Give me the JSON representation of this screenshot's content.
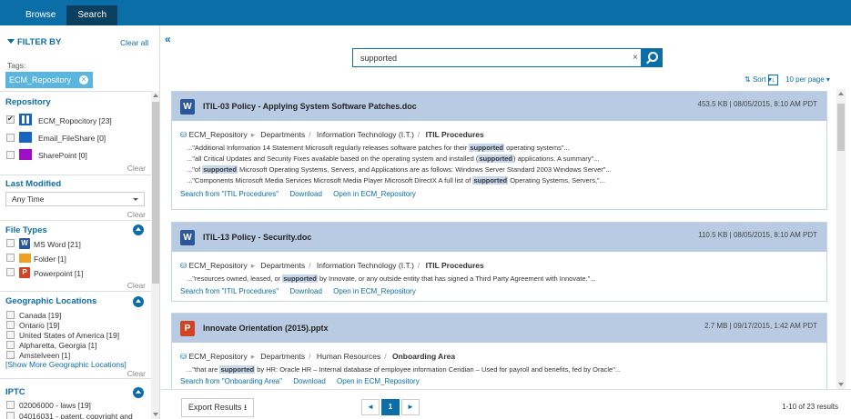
{
  "topbar": {
    "tabs": [
      {
        "label": "Browse"
      },
      {
        "label": "Search"
      }
    ]
  },
  "sidebar": {
    "filter_by": "FILTER BY",
    "clear_all": "Clear all",
    "tags_label": "Tags:",
    "tag_chip": "ECM_Repository",
    "repository": {
      "title": "Repository",
      "items": [
        {
          "label": "ECM_Ropocitory [23]",
          "checked": true
        },
        {
          "label": "Email_FileShare [0]",
          "checked": false
        },
        {
          "label": "SharePoint [0]",
          "checked": false
        }
      ],
      "clear": "Clear"
    },
    "last_modified": {
      "title": "Last Modified",
      "value": "Any Time",
      "clear": "Clear"
    },
    "file_types": {
      "title": "File Types",
      "items": [
        {
          "label": "MS Word [21]"
        },
        {
          "label": "Folder [1]"
        },
        {
          "label": "Powerpoint [1]"
        }
      ],
      "clear": "Clear"
    },
    "geo": {
      "title": "Geographic Locations",
      "items": [
        {
          "label": "Canada [19]"
        },
        {
          "label": "Ontario [19]"
        },
        {
          "label": "United States of America [19]"
        },
        {
          "label": "Alpharetta, Georgia [1]"
        },
        {
          "label": "Amstelveen [1]"
        }
      ],
      "show_more": "[Show More Geographic Locations]",
      "clear": "Clear"
    },
    "iptc": {
      "title": "IPTC",
      "items": [
        {
          "label": "02006000 - laws [19]"
        },
        {
          "label": "04016031 - patent, copyright and"
        }
      ]
    }
  },
  "search": {
    "collapse_glyph": "«",
    "value": "supported",
    "clear_glyph": "×"
  },
  "toolbar": {
    "sort": "Sort",
    "per_page": "10 per page"
  },
  "results": [
    {
      "title": "ITIL-03 Policy - Applying System Software Patches.doc",
      "meta": "453.5 KB  |  08/05/2015, 8:10 AM PDT",
      "icon_letter": "W",
      "breadcrumb": [
        "ECM_Repository",
        "Departments",
        "Information Technology (I.T.)",
        "ITIL Procedures"
      ],
      "snippets": [
        [
          "...\"Additional Information 14 Statement Microsoft regularly releases software patches for their ",
          "supported",
          " operating systems\"..."
        ],
        [
          "...\"all Critical Updates and Security Fixes available based on the operating system and installed (",
          "supported",
          ") applications. A summary\"..."
        ],
        [
          "...\"of ",
          "supported",
          " Microsoft Operating Systems, Servers, and Applications are as follows: Windows Server Standard 2003 Windows Server\"..."
        ],
        [
          "...\"Components Microsoft Media Services Microsoft Media Player Microsoft DirectX A full list of ",
          "supported",
          " Operating Systems, Servers,\"..."
        ]
      ],
      "links": [
        "Search from \"ITIL Procedures\"",
        "Download",
        "Open in ECM_Repository"
      ]
    },
    {
      "title": "ITIL-13 Policy - Security.doc",
      "meta": "110.5 KB  |  08/05/2015, 8:10 AM PDT",
      "icon_letter": "W",
      "breadcrumb": [
        "ECM_Repository",
        "Departments",
        "Information Technology (I.T.)",
        "ITIL Procedures"
      ],
      "snippets": [
        [
          "...\"resources owned, leased, or ",
          "supported",
          " by Innovate, or any outside entity that has signed a Third Party Agreement with Innovate.\"..."
        ]
      ],
      "links": [
        "Search from \"ITIL Procedures\"",
        "Download",
        "Open in ECM_Repository"
      ]
    },
    {
      "title": "Innovate Orientation (2015).pptx",
      "meta": "2.7 MB  |  09/17/2015, 1:42 AM PDT",
      "icon_letter": "P",
      "breadcrumb": [
        "ECM_Repository",
        "Departments",
        "Human Resources",
        "Onboarding Area"
      ],
      "snippets": [
        [
          "...\"that are ",
          "supported",
          " by HR: Oracle HR – Internal database of employee information Ceridian – Used for payroll and benefits, fed by Oracle\"..."
        ]
      ],
      "links": [
        "Search from \"Onboarding Area\"",
        "Download",
        "Open in ECM_Repository"
      ]
    }
  ],
  "footer": {
    "export": "Export Results",
    "page": "1",
    "count": "1-10 of 23 results"
  },
  "colors": {
    "brand": "#0b6ea6",
    "tab_active": "#0a3f5f",
    "card_head": "#b9cbe3",
    "tag": "#5ab5e0"
  }
}
